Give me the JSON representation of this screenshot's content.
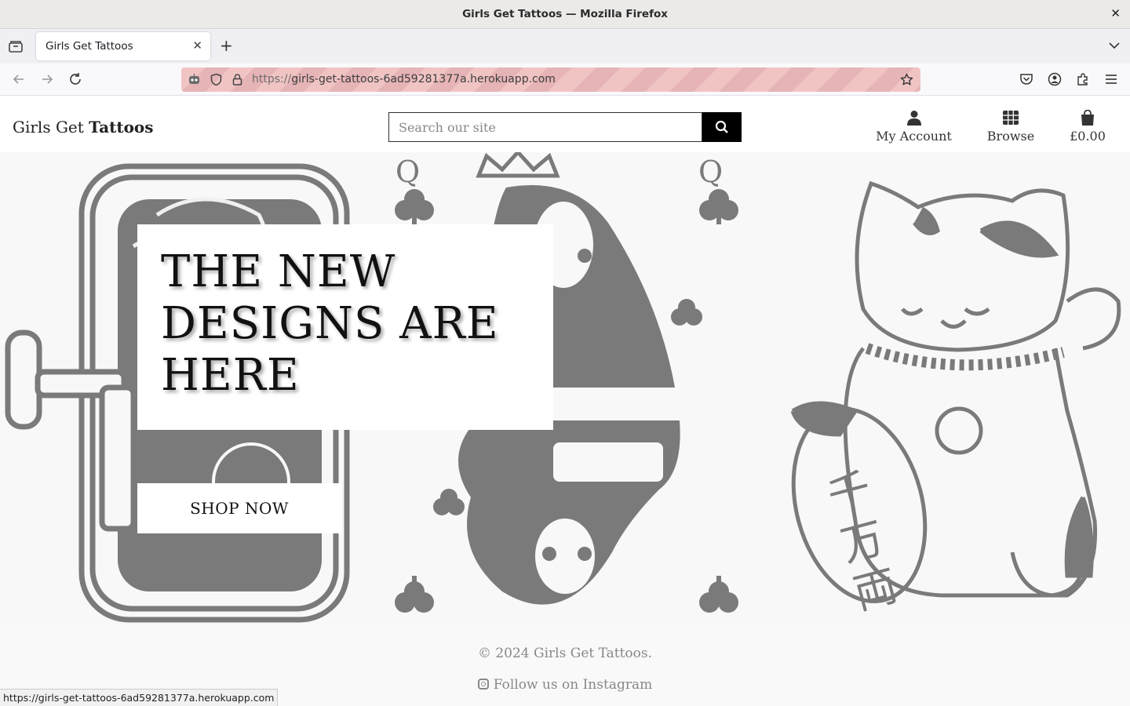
{
  "window": {
    "title": "Girls Get Tattoos — Mozilla Firefox",
    "close_glyph": "✕"
  },
  "browser": {
    "tab": {
      "label": "Girls Get Tattoos",
      "close_glyph": "✕"
    },
    "new_tab_glyph": "+",
    "url": {
      "scheme": "https://",
      "host": "girls-get-tattoos-6ad59281377a.herokuapp.com"
    },
    "status_url": "https://girls-get-tattoos-6ad59281377a.herokuapp.com",
    "urlbar_stripe_colors": [
      "#f1c4c4",
      "#e6b4b6"
    ]
  },
  "header": {
    "brand_plain": "Girls Get ",
    "brand_bold": "Tattoos",
    "search_placeholder": "Search our site",
    "nav": [
      {
        "label": "My Account",
        "icon": "user-icon"
      },
      {
        "label": "Browse",
        "icon": "grid-icon"
      },
      {
        "label": "£0.00",
        "icon": "shopping-bag-icon"
      }
    ]
  },
  "hero": {
    "headline": "THE NEW DESIGNS ARE HERE",
    "cta_label": "SHOP NOW",
    "artwork": [
      "sardine-tin-illustration",
      "queen-of-clubs-card-illustration",
      "maneki-neko-cat-illustration"
    ],
    "art_color": "#7a7a7a"
  },
  "footer": {
    "copyright": "© 2024 Girls Get Tattoos.",
    "instagram_label": "Follow us on Instagram",
    "instagram_icon": "instagram-icon"
  }
}
